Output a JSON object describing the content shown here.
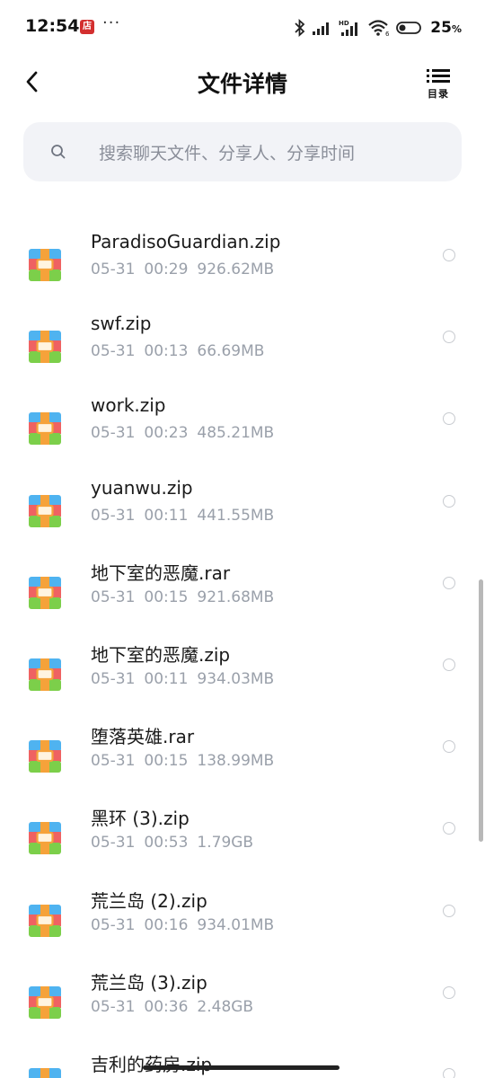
{
  "status_bar": {
    "time": "12:54",
    "badge": "店",
    "dots": "···",
    "battery_percent": "25",
    "battery_unit": "%"
  },
  "header": {
    "title": "文件详情",
    "catalog_label": "目录"
  },
  "search": {
    "placeholder": "搜索聊天文件、分享人、分享时间"
  },
  "files": [
    {
      "name": "ParadisoGuardian.zip",
      "date": "05-31",
      "time": "00:29",
      "size": "926.62MB"
    },
    {
      "name": "swf.zip",
      "date": "05-31",
      "time": "00:13",
      "size": "66.69MB"
    },
    {
      "name": "work.zip",
      "date": "05-31",
      "time": "00:23",
      "size": "485.21MB"
    },
    {
      "name": "yuanwu.zip",
      "date": "05-31",
      "time": "00:11",
      "size": "441.55MB"
    },
    {
      "name": "地下室的恶魔.rar",
      "date": "05-31",
      "time": "00:15",
      "size": "921.68MB"
    },
    {
      "name": "地下室的恶魔.zip",
      "date": "05-31",
      "time": "00:11",
      "size": "934.03MB"
    },
    {
      "name": "堕落英雄.rar",
      "date": "05-31",
      "time": "00:15",
      "size": "138.99MB"
    },
    {
      "name": "黑环 (3).zip",
      "date": "05-31",
      "time": "00:53",
      "size": "1.79GB"
    },
    {
      "name": "荒兰岛 (2).zip",
      "date": "05-31",
      "time": "00:16",
      "size": "934.01MB"
    },
    {
      "name": "荒兰岛 (3).zip",
      "date": "05-31",
      "time": "00:36",
      "size": "2.48GB"
    },
    {
      "name": "吉利的药房.zip",
      "date": "",
      "time": "",
      "size": ""
    }
  ],
  "colors": {
    "archive_blue": "#4fb3f0",
    "archive_red": "#ef6262",
    "archive_green": "#7ccf4a",
    "archive_strap": "#f5a23a"
  }
}
